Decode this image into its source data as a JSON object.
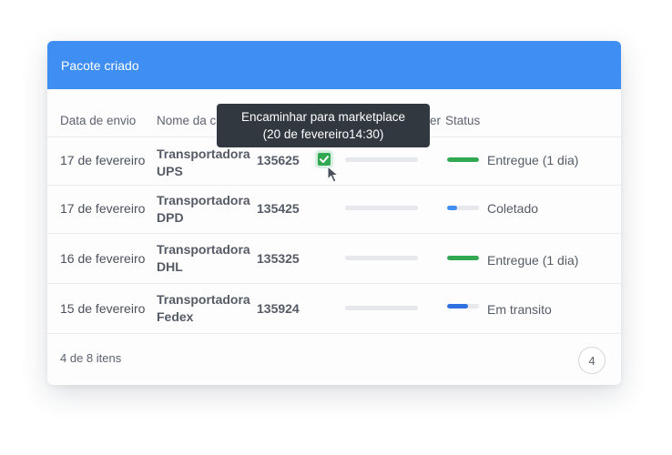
{
  "card": {
    "title": "Pacote criado"
  },
  "columns": {
    "date": "Data de envio",
    "carrier": "Nome da c",
    "tracking_tail": "er",
    "status": "Status"
  },
  "rows": [
    {
      "date": "17 de fevereiro",
      "carrier_line1": "Transportadora",
      "carrier_line2": "UPS",
      "package": "135625",
      "status": "Entregue (1 dia)",
      "status_progress": 1.0,
      "status_color": "#33a853"
    },
    {
      "date": "17 de fevereiro",
      "carrier_line1": "Transportadora",
      "carrier_line2": "DPD",
      "package": "135425",
      "status": "Coletado",
      "status_progress": 0.3,
      "status_color": "#3e8ef3"
    },
    {
      "date": "16 de fevereiro",
      "carrier_line1": "Transportadora",
      "carrier_line2": "DHL",
      "package": "135325",
      "status": "Entregue (1 dia)",
      "status_progress": 1.0,
      "status_color": "#33a853"
    },
    {
      "date": "15 de fevereiro",
      "carrier_line1": "Transportadora",
      "carrier_line2": "Fedex",
      "package": "135924",
      "status": "Em transito",
      "status_progress": 0.65,
      "status_color": "#2f6fe0"
    }
  ],
  "tooltip": {
    "line1": "Encaminhar para marketplace",
    "line2": "(20 de fevereiro14:30)"
  },
  "footer": {
    "count": "4 de 8 itens",
    "page": "4"
  },
  "colors": {
    "header": "#3e8ef3",
    "delivered": "#33a853",
    "in_progress": "#3e8ef3"
  },
  "icons": {
    "checkbox": "checkbox-checked-icon",
    "cursor": "mouse-pointer-icon"
  }
}
